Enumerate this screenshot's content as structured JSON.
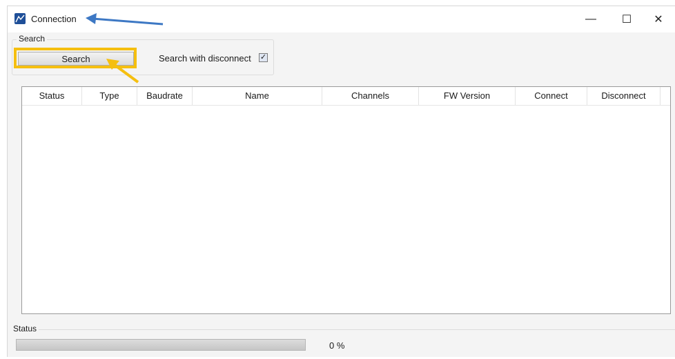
{
  "window": {
    "title": "Connection"
  },
  "search_group": {
    "legend": "Search",
    "search_button": "Search",
    "disconnect_label": "Search with disconnect",
    "disconnect_checked": true,
    "check_glyph": "✓"
  },
  "table": {
    "columns": [
      "Status",
      "Type",
      "Baudrate",
      "Name",
      "Channels",
      "FW Version",
      "Connect",
      "Disconnect"
    ],
    "rows": []
  },
  "status_group": {
    "legend": "Status",
    "progress_percent": 0,
    "progress_text": "0 %"
  },
  "title_buttons": {
    "minimize": "—",
    "maximize": "☐",
    "close": "✕"
  },
  "colors": {
    "highlight": "#f5bf10",
    "arrow_blue": "#3d78c4",
    "arrow_orange": "#f5bf10",
    "app_icon": "#1f4f98"
  },
  "icons": [
    "app-chart-icon",
    "minimize-icon",
    "maximize-icon",
    "close-icon",
    "checkbox-check-icon"
  ]
}
